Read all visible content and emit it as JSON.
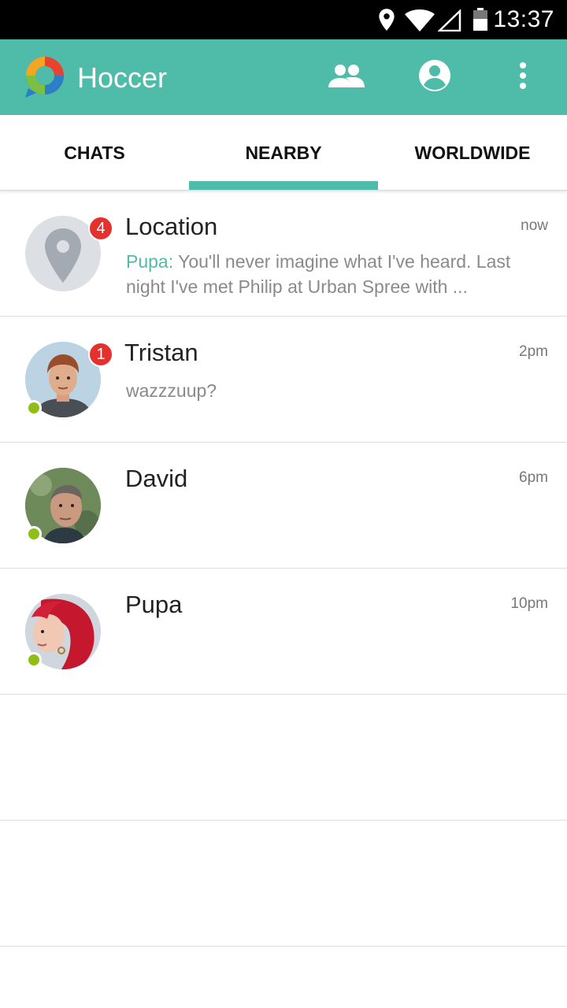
{
  "status_bar": {
    "time": "13:37",
    "icons": [
      "location-icon",
      "wifi-icon",
      "signal-icon",
      "battery-icon"
    ]
  },
  "app_bar": {
    "title": "Hoccer",
    "actions": [
      "contacts-icon",
      "profile-icon",
      "more-icon"
    ],
    "color": "#4fbba9"
  },
  "tabs": [
    {
      "label": "CHATS",
      "active": false
    },
    {
      "label": "NEARBY",
      "active": true
    },
    {
      "label": "WORLDWIDE",
      "active": false
    }
  ],
  "chats": [
    {
      "name": "Location",
      "time": "now",
      "badge": "4",
      "sender": "Pupa:",
      "message": "You'll never imagine what I've heard. Last night I've met Philip at Urban Spree with ...",
      "avatar": "location-pin-icon",
      "online": false
    },
    {
      "name": "Tristan",
      "time": "2pm",
      "badge": "1",
      "sender": "",
      "message": "wazzzuup?",
      "avatar": "tristan-avatar",
      "online": true
    },
    {
      "name": "David",
      "time": "6pm",
      "badge": "",
      "sender": "",
      "message": "",
      "avatar": "david-avatar",
      "online": true
    },
    {
      "name": "Pupa",
      "time": "10pm",
      "badge": "",
      "sender": "",
      "message": "",
      "avatar": "pupa-avatar",
      "online": true
    }
  ],
  "colors": {
    "accent": "#4fbba9",
    "badge": "#e5312e",
    "online": "#8fbf16"
  }
}
